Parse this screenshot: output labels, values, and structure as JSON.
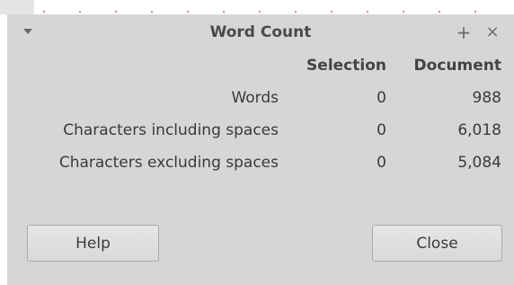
{
  "dialog": {
    "title": "Word Count",
    "titlebar_plus": "+",
    "titlebar_close": "×"
  },
  "stats": {
    "headers": {
      "selection": "Selection",
      "document": "Document"
    },
    "rows": [
      {
        "label": "Words",
        "selection": "0",
        "document": "988"
      },
      {
        "label": "Characters including spaces",
        "selection": "0",
        "document": "6,018"
      },
      {
        "label": "Characters excluding spaces",
        "selection": "0",
        "document": "5,084"
      }
    ]
  },
  "buttons": {
    "help": "Help",
    "close": "Close"
  },
  "colors": {
    "dialog_bg": "#d6d6d6",
    "text": "#3a3a3a",
    "button_border": "#a9a9a9"
  }
}
